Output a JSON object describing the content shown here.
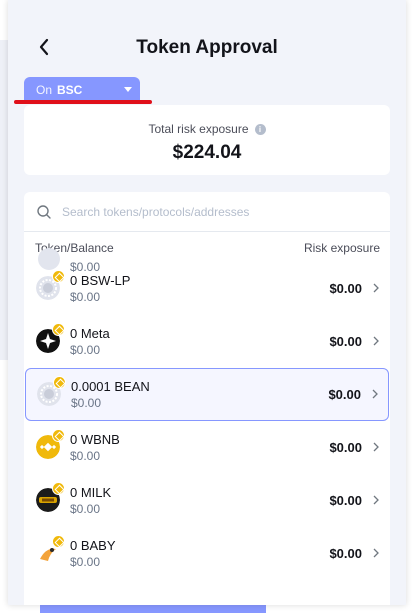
{
  "header": {
    "title": "Token Approval",
    "back_icon": "chevron-left-icon"
  },
  "chain_selector": {
    "prefix": "On",
    "chain": "BSC",
    "accent_color": "#8697ff"
  },
  "risk_summary": {
    "label": "Total risk exposure",
    "value": "$224.04"
  },
  "search": {
    "placeholder": "Search tokens/protocols/addresses"
  },
  "columns": {
    "token": "Token/Balance",
    "risk": "Risk exposure"
  },
  "partial_row": {
    "value": "$0.00"
  },
  "tokens": [
    {
      "name": "0 BSW-LP",
      "value": "$0.00",
      "risk": "$0.00",
      "logo": "bsw-lp-logo",
      "selected": false
    },
    {
      "name": "0 Meta",
      "value": "$0.00",
      "risk": "$0.00",
      "logo": "meta-logo",
      "selected": false
    },
    {
      "name": "0.0001 BEAN",
      "value": "$0.00",
      "risk": "$0.00",
      "logo": "bean-logo",
      "selected": true
    },
    {
      "name": "0 WBNB",
      "value": "$0.00",
      "risk": "$0.00",
      "logo": "wbnb-logo",
      "selected": false
    },
    {
      "name": "0 MILK",
      "value": "$0.00",
      "risk": "$0.00",
      "logo": "milk-logo",
      "selected": false
    },
    {
      "name": "0 BABY",
      "value": "$0.00",
      "risk": "$0.00",
      "logo": "baby-logo",
      "selected": false
    }
  ]
}
